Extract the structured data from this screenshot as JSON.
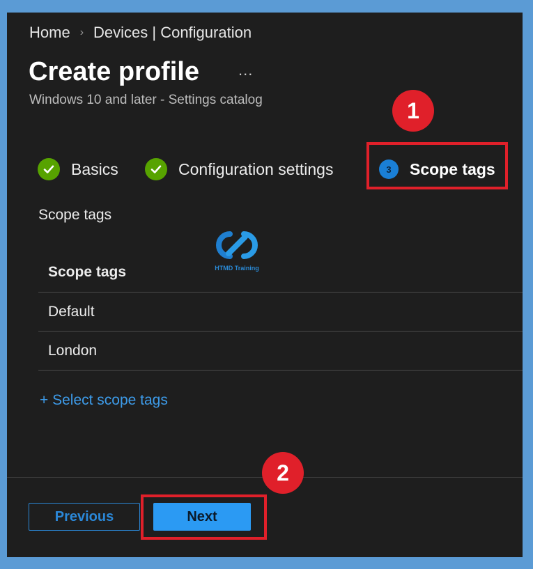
{
  "breadcrumb": {
    "home": "Home",
    "separator": "›",
    "current": "Devices | Configuration"
  },
  "header": {
    "title": "Create profile",
    "more": "...",
    "subtitle": "Windows 10 and later - Settings catalog"
  },
  "steps": [
    {
      "label": "Basics",
      "state": "complete",
      "icon": "check-icon"
    },
    {
      "label": "Configuration settings",
      "state": "complete",
      "icon": "check-icon"
    },
    {
      "label": "Scope tags",
      "state": "active",
      "number": "3"
    }
  ],
  "section": {
    "label": "Scope tags"
  },
  "watermark": {
    "text": "HTMD Training"
  },
  "table": {
    "header": "Scope tags",
    "rows": [
      "Default",
      "London"
    ]
  },
  "select_link": "+ Select scope tags",
  "footer": {
    "previous": "Previous",
    "next": "Next"
  },
  "annotations": {
    "first": "1",
    "second": "2"
  },
  "colors": {
    "accent": "#2b9af3",
    "success": "#57a300",
    "annotation": "#e0202a",
    "background": "#1e1e1e"
  }
}
